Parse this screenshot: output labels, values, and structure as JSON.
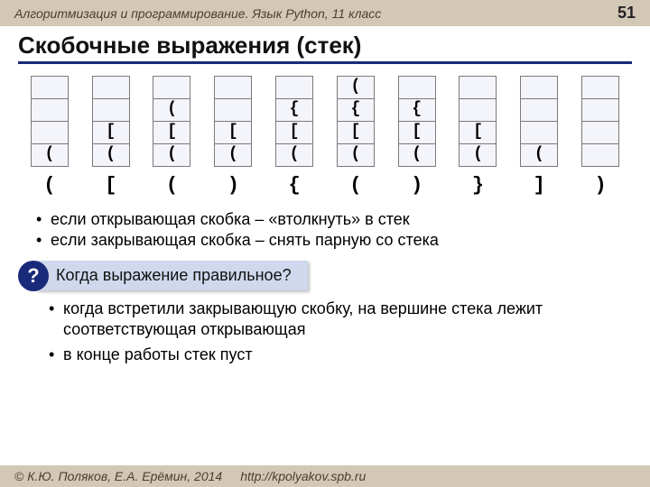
{
  "header": {
    "course": "Алгоритмизация и программирование. Язык Python, 11 класс",
    "page": "51"
  },
  "title": "Скобочные выражения (стек)",
  "stacks": {
    "height": 4,
    "columns": [
      {
        "cells": [
          "",
          "",
          "",
          "("
        ],
        "below": "("
      },
      {
        "cells": [
          "",
          "",
          "[",
          "("
        ],
        "below": "["
      },
      {
        "cells": [
          "",
          "(",
          "[",
          "("
        ],
        "below": "("
      },
      {
        "cells": [
          "",
          "",
          "[",
          "("
        ],
        "below": ")"
      },
      {
        "cells": [
          "",
          "{",
          "[",
          "("
        ],
        "below": "{"
      },
      {
        "cells": [
          "(",
          "{",
          "[",
          "("
        ],
        "below": "("
      },
      {
        "cells": [
          "",
          "{",
          "[",
          "("
        ],
        "below": ")"
      },
      {
        "cells": [
          "",
          "",
          "[",
          "("
        ],
        "below": "}"
      },
      {
        "cells": [
          "",
          "",
          "",
          "("
        ],
        "below": "]"
      },
      {
        "cells": [
          "",
          "",
          "",
          ""
        ],
        "below": ")"
      }
    ]
  },
  "rules": [
    "если открывающая скобка – «втолкнуть» в стек",
    "если закрывающая скобка – снять парную со стека"
  ],
  "question": {
    "mark": "?",
    "text": "Когда выражение правильное?"
  },
  "answers": [
    "когда встретили закрывающую скобку, на вершине стека лежит соответствующая открывающая",
    "в конце работы стек пуст"
  ],
  "footer": {
    "copyright": "© К.Ю. Поляков, Е.А. Ерёмин, 2014",
    "url": "http://kpolyakov.spb.ru"
  }
}
